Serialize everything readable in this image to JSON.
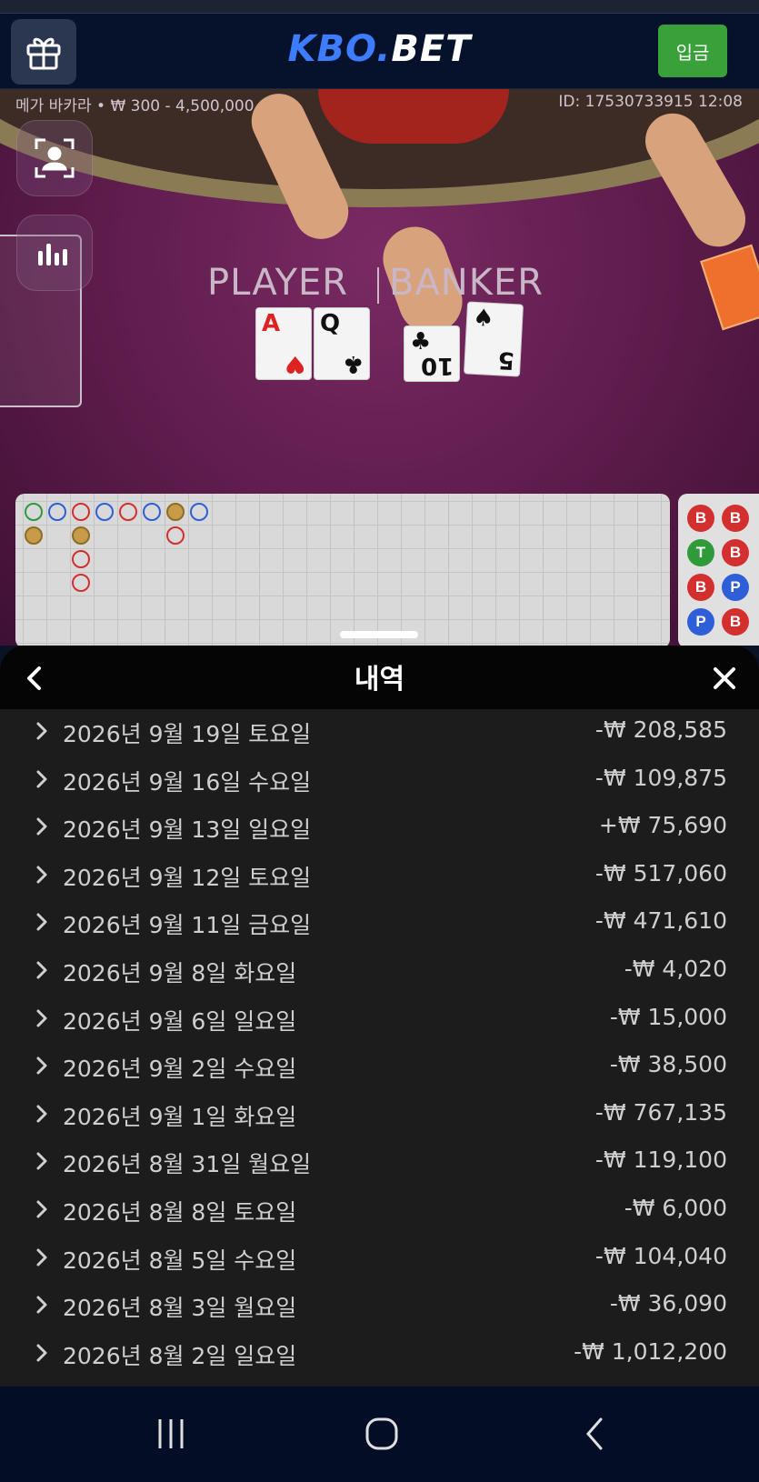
{
  "header": {
    "logo_part1": "KBO.",
    "logo_part2": "BET",
    "deposit_label": "입금"
  },
  "game": {
    "table_info": "메가 바카라 • ₩ 300 - 4,500,000",
    "round_id": "ID: 17530733915 12:08",
    "player_label": "PLAYER",
    "banker_label": "BANKER",
    "player_cards": [
      {
        "rank": "A",
        "suit": "♥",
        "color": "red"
      },
      {
        "rank": "Q",
        "suit": "♣",
        "color": "black"
      }
    ],
    "banker_cards": [
      {
        "rank": "10",
        "suit": "♣",
        "color": "black"
      },
      {
        "rank": "5",
        "suit": "♠",
        "color": "black"
      }
    ],
    "roadmap": [
      "B",
      "B",
      "T",
      "B",
      "B",
      "P",
      "P",
      "B"
    ]
  },
  "history": {
    "title": "내역",
    "rows": [
      {
        "date": "2026년 9월 19일 토요일",
        "amount": "-₩ 208,585"
      },
      {
        "date": "2026년 9월 16일 수요일",
        "amount": "-₩ 109,875"
      },
      {
        "date": "2026년 9월 13일 일요일",
        "amount": "+₩ 75,690"
      },
      {
        "date": "2026년 9월 12일 토요일",
        "amount": "-₩ 517,060"
      },
      {
        "date": "2026년 9월 11일 금요일",
        "amount": "-₩ 471,610"
      },
      {
        "date": "2026년 9월 8일 화요일",
        "amount": "-₩ 4,020"
      },
      {
        "date": "2026년 9월 6일 일요일",
        "amount": "-₩ 15,000"
      },
      {
        "date": "2026년 9월 2일 수요일",
        "amount": "-₩ 38,500"
      },
      {
        "date": "2026년 9월 1일 화요일",
        "amount": "-₩ 767,135"
      },
      {
        "date": "2026년 8월 31일 월요일",
        "amount": "-₩ 119,100"
      },
      {
        "date": "2026년 8월 8일 토요일",
        "amount": "-₩ 6,000"
      },
      {
        "date": "2026년 8월 5일 수요일",
        "amount": "-₩ 104,040"
      },
      {
        "date": "2026년 8월 3일 월요일",
        "amount": "-₩ 36,090"
      },
      {
        "date": "2026년 8월 2일 일요일",
        "amount": "-₩ 1,012,200"
      }
    ]
  },
  "icons": {
    "gift": "gift-icon",
    "camera": "user-frame-icon",
    "stats": "stats-icon",
    "back": "chevron-left-icon",
    "close": "close-icon",
    "row_chevron": "chevron-right-icon",
    "nav_recent": "recent-apps-icon",
    "nav_home": "home-icon",
    "nav_back": "back-icon"
  },
  "colors": {
    "deposit": "#3aa03a",
    "logo_accent": "#3d7bff",
    "banker": "#d32f2f",
    "player": "#2e5fd8",
    "tie": "#2f9a3a"
  }
}
